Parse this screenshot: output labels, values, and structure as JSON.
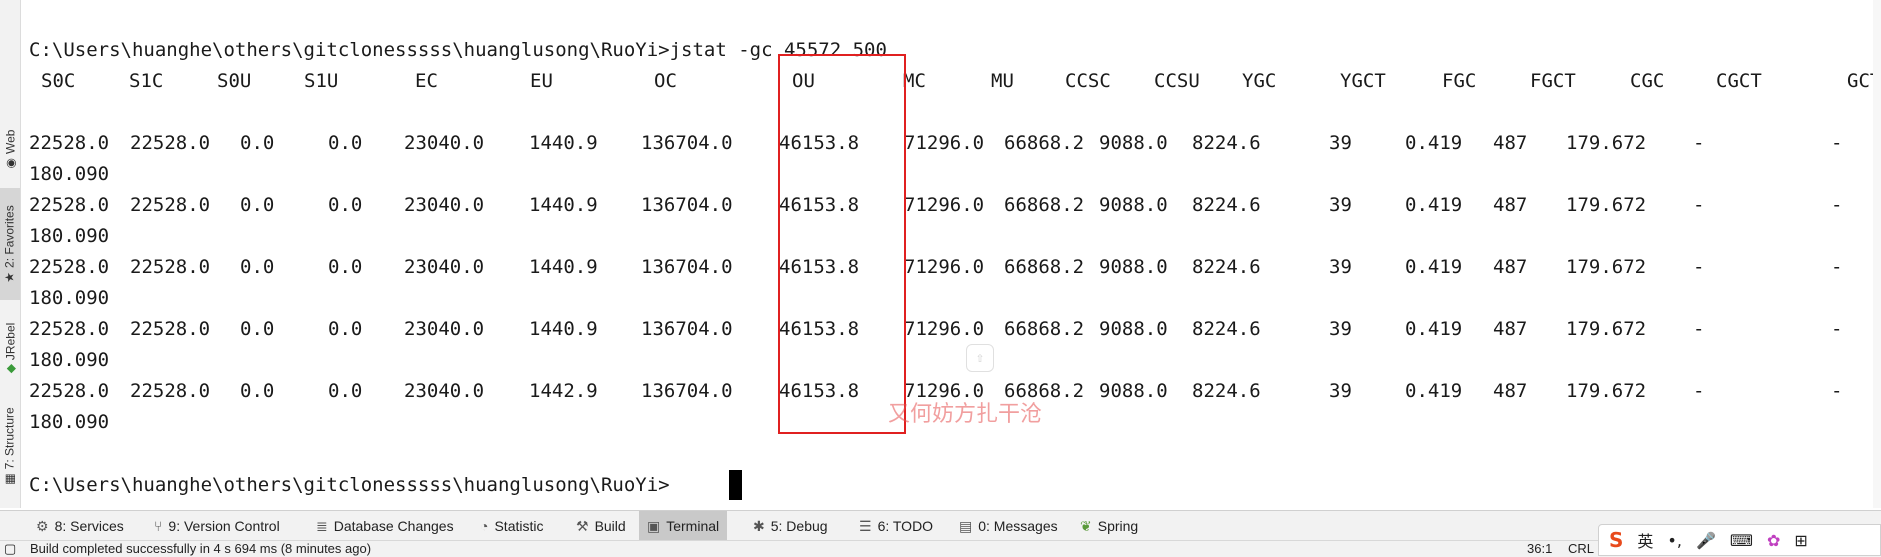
{
  "sidebar": {
    "tabs": [
      {
        "label": "Web",
        "icon": "web-icon"
      },
      {
        "label": "2: Favorites",
        "icon": "star-icon"
      },
      {
        "label": "JRebel",
        "icon": "jrebel-icon"
      },
      {
        "label": "7: Structure",
        "icon": "structure-icon"
      }
    ]
  },
  "terminal": {
    "command": "C:\\Users\\huanghe\\others\\gitclonesssss\\huanglusong\\RuoYi>jstat -gc 45572 500",
    "headers": [
      "S0C",
      "S1C",
      "S0U",
      "S1U",
      "EC",
      "EU",
      "OC",
      "OU",
      "MC",
      "MU",
      "CCSC",
      "CCSU",
      "YGC",
      "YGCT",
      "FGC",
      "FGCT",
      "CGC",
      "CGCT",
      "GCT"
    ],
    "rows": [
      {
        "values": [
          "22528.0",
          "22528.0",
          "0.0",
          "0.0",
          "23040.0",
          "1440.9",
          "136704.0",
          "46153.8",
          "71296.0",
          "66868.2",
          "9088.0",
          "8224.6",
          "39",
          "0.419",
          "487",
          "179.672",
          "-",
          "-"
        ],
        "wrap": "180.090"
      },
      {
        "values": [
          "22528.0",
          "22528.0",
          "0.0",
          "0.0",
          "23040.0",
          "1440.9",
          "136704.0",
          "46153.8",
          "71296.0",
          "66868.2",
          "9088.0",
          "8224.6",
          "39",
          "0.419",
          "487",
          "179.672",
          "-",
          "-"
        ],
        "wrap": "180.090"
      },
      {
        "values": [
          "22528.0",
          "22528.0",
          "0.0",
          "0.0",
          "23040.0",
          "1440.9",
          "136704.0",
          "46153.8",
          "71296.0",
          "66868.2",
          "9088.0",
          "8224.6",
          "39",
          "0.419",
          "487",
          "179.672",
          "-",
          "-"
        ],
        "wrap": "180.090"
      },
      {
        "values": [
          "22528.0",
          "22528.0",
          "0.0",
          "0.0",
          "23040.0",
          "1440.9",
          "136704.0",
          "46153.8",
          "71296.0",
          "66868.2",
          "9088.0",
          "8224.6",
          "39",
          "0.419",
          "487",
          "179.672",
          "-",
          "-"
        ],
        "wrap": "180.090"
      },
      {
        "values": [
          "22528.0",
          "22528.0",
          "0.0",
          "0.0",
          "23040.0",
          "1442.9",
          "136704.0",
          "46153.8",
          "71296.0",
          "66868.2",
          "9088.0",
          "8224.6",
          "39",
          "0.419",
          "487",
          "179.672",
          "-",
          "-"
        ],
        "wrap": "180.090"
      }
    ],
    "prompt": "C:\\Users\\huanghe\\others\\gitclonesssss\\huanglusong\\RuoYi>",
    "watermark": "又何妨方扎干沧"
  },
  "toolbar": {
    "items": [
      {
        "label": "8: Services",
        "icon": "services-icon"
      },
      {
        "label": "9: Version Control",
        "icon": "version-control-icon"
      },
      {
        "label": "Database Changes",
        "icon": "database-icon"
      },
      {
        "label": "Statistic",
        "icon": "statistic-icon"
      },
      {
        "label": "Build",
        "icon": "build-icon"
      },
      {
        "label": "Terminal",
        "icon": "terminal-icon",
        "active": true
      },
      {
        "label": "5: Debug",
        "icon": "debug-icon"
      },
      {
        "label": "6: TODO",
        "icon": "todo-icon"
      },
      {
        "label": "0: Messages",
        "icon": "messages-icon"
      },
      {
        "label": "Spring",
        "icon": "spring-icon"
      }
    ]
  },
  "statusbar": {
    "message": "Build completed successfully in 4 s 694 ms (8 minutes ago)",
    "position": "36:1",
    "encoding": "CRL"
  },
  "ime": {
    "language": "英"
  },
  "colors": {
    "highlight": "#e02020",
    "accent_ime": "#e84a1c"
  }
}
